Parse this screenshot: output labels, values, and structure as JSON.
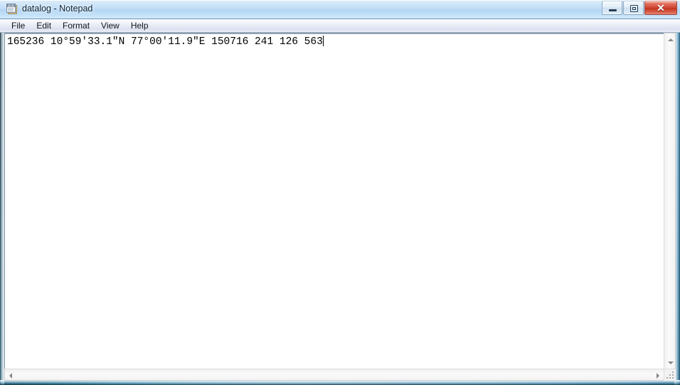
{
  "window": {
    "title": "datalog - Notepad",
    "app_icon": "notepad-icon",
    "controls": {
      "minimize_label": "Minimize",
      "maximize_label": "Maximize",
      "close_label": "Close",
      "close_glyph": "✕",
      "close_color": "#c2341f"
    }
  },
  "menubar": {
    "items": [
      {
        "label": "File"
      },
      {
        "label": "Edit"
      },
      {
        "label": "Format"
      },
      {
        "label": "View"
      },
      {
        "label": "Help"
      }
    ]
  },
  "editor": {
    "lines": [
      "165236 10°59'33.1\"N 77°00'11.9\"E 150716 241 126 563"
    ],
    "line_1": "165236 10°59'33.1\"N 77°00'11.9\"E 150716 241 126 563",
    "caret_visible": true,
    "word_wrap": false,
    "background_color": "#ffffff",
    "text_color": "#000000"
  },
  "scrollbars": {
    "vertical": {
      "up_arrow": "scroll-up-arrow",
      "down_arrow": "scroll-down-arrow"
    },
    "horizontal": {
      "left_arrow": "scroll-left-arrow",
      "right_arrow": "scroll-right-arrow"
    },
    "resize_grip": "resize-grip"
  }
}
